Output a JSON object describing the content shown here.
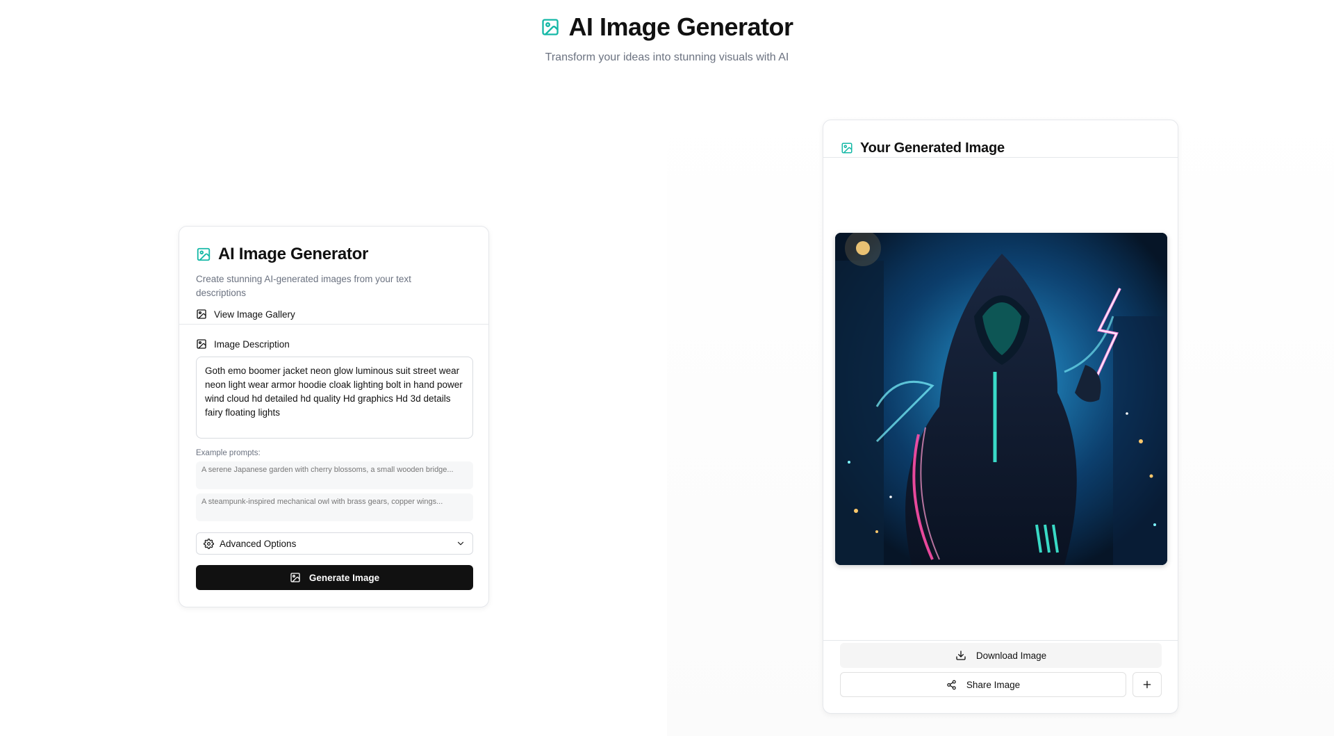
{
  "header": {
    "icon": "image-icon",
    "title": "AI Image Generator",
    "subtitle": "Transform your ideas into stunning visuals with AI"
  },
  "generator_card": {
    "icon": "image-icon",
    "title": "AI Image Generator",
    "description": "Create stunning AI-generated images from your text descriptions",
    "gallery_link": "View Image Gallery",
    "field_label": "Image Description",
    "prompt_value": "Goth emo boomer jacket neon glow luminous suit street wear neon light wear armor hoodie cloak lighting bolt in hand power wind cloud hd detailed hd quality Hd graphics Hd 3d details fairy floating lights",
    "examples_label": "Example prompts:",
    "examples": [
      "A serene Japanese garden with cherry blossoms, a small wooden bridge...",
      "A steampunk-inspired mechanical owl with brass gears, copper wings..."
    ],
    "advanced_label": "Advanced Options",
    "generate_label": "Generate Image"
  },
  "result_card": {
    "icon": "image-icon",
    "title": "Your Generated Image",
    "download_label": "Download Image",
    "share_label": "Share Image"
  },
  "colors": {
    "accent": "#14b8a6",
    "primary_button": "#111111"
  }
}
